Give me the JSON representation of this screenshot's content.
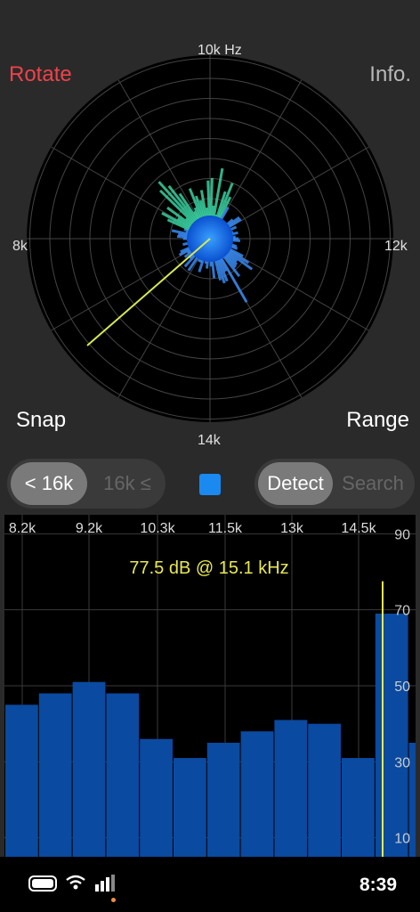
{
  "buttons": {
    "rotate": "Rotate",
    "info": "Info.",
    "snap": "Snap",
    "range": "Range"
  },
  "polar": {
    "top": "10k Hz",
    "left": "8k",
    "right": "12k",
    "bottom": "14k"
  },
  "freq_toggle": {
    "below": "< 16k",
    "above": "16k ≤",
    "selected": "below"
  },
  "mode_toggle": {
    "detect": "Detect",
    "search": "Search",
    "selected": "detect"
  },
  "swatch_color": "#1a8af0",
  "spectrum": {
    "readout": "77.5 dB @ 15.1 kHz",
    "freq_ticks": [
      "8.2k",
      "9.2k",
      "10.3k",
      "11.5k",
      "13k",
      "14.5k"
    ],
    "db_ticks": [
      "90",
      "70",
      "50",
      "30",
      "10"
    ]
  },
  "chart_data": {
    "type": "bar",
    "ylim": [
      5,
      95
    ],
    "values": [
      45,
      48,
      51,
      48,
      36,
      31,
      35,
      38,
      41,
      40,
      31,
      69,
      35
    ],
    "marker_freq_label": "15.1 kHz",
    "marker_db": 77.5,
    "bar_color": "#0a4aa0",
    "marker_color": "#e8e850"
  },
  "status_bar": {
    "time": "8:39"
  }
}
